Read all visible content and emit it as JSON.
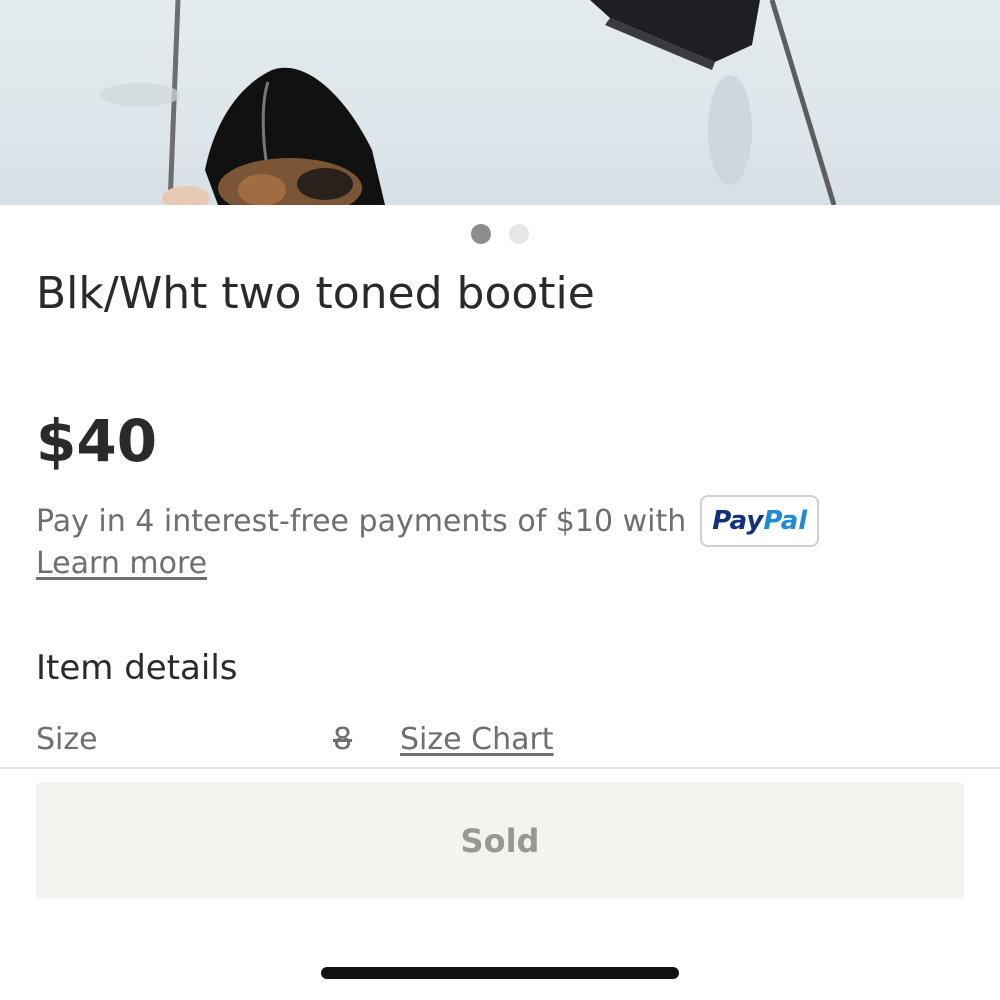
{
  "listing": {
    "title": "Blk/Wht two toned bootie",
    "price": "$40",
    "images": {
      "count": 2,
      "active_index": 0
    }
  },
  "financing": {
    "text": "Pay in 4 interest-free payments of $10 with",
    "badge_part1": "Pay",
    "badge_part2": "Pal",
    "learn_more": "Learn more"
  },
  "details": {
    "heading": "Item details",
    "size_label": "Size",
    "size_value": "8",
    "size_chart_link": "Size Chart"
  },
  "action": {
    "button_label": "Sold"
  },
  "colors": {
    "paypal_dark": "#14307a",
    "paypal_light": "#1f8ad6",
    "sold_button_bg": "#f5f3f0"
  }
}
